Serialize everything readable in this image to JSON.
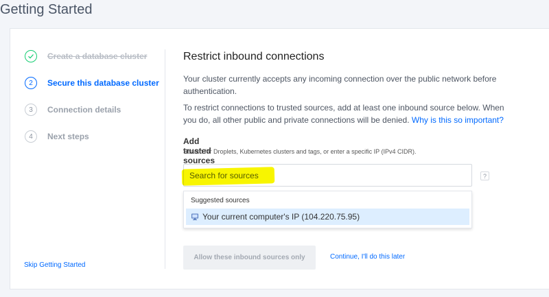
{
  "page": {
    "title": "Getting Started"
  },
  "steps": [
    {
      "number": "",
      "label": "Create a database cluster",
      "status": "done"
    },
    {
      "number": "2",
      "label": "Secure this database cluster",
      "status": "active"
    },
    {
      "number": "3",
      "label": "Connection details",
      "status": "pending"
    },
    {
      "number": "4",
      "label": "Next steps",
      "status": "pending"
    }
  ],
  "sidebar": {
    "skip_label": "Skip Getting Started"
  },
  "main": {
    "title": "Restrict inbound connections",
    "intro": "Your cluster currently accepts any incoming connection over the public network before authentication.",
    "restrict_text": "To restrict connections to trusted sources, add at least one inbound source below. When you do, all other public and private connections will be denied.",
    "why_link": "Why is this so important?",
    "sources_label": "Add trusted sources",
    "sources_help": "Search for Droplets, Kubernetes clusters and tags, or enter a specific IP (IPv4 CIDR).",
    "search": {
      "placeholder": "Search for sources",
      "value": ""
    },
    "help_glyph": "?",
    "suggested": {
      "heading": "Suggested sources",
      "items": [
        {
          "icon": "computer-icon",
          "label": "Your current computer's IP (104.220.75.95)"
        }
      ]
    },
    "allow_button": "Allow these inbound sources only",
    "continue_link": "Continue, I'll do this later"
  },
  "colors": {
    "accent": "#0069ff",
    "success": "#15cd72",
    "highlight": "#f8f500",
    "background": "#f3f5f9"
  }
}
